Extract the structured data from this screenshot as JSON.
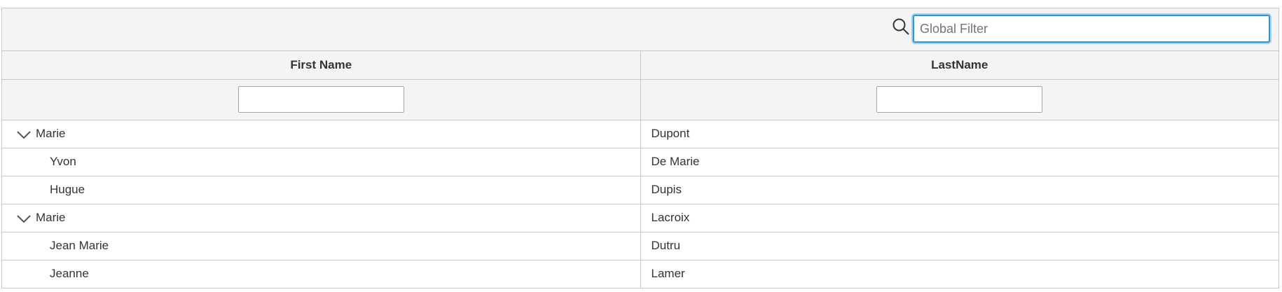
{
  "global_filter": {
    "placeholder": "Global Filter",
    "value": ""
  },
  "columns": [
    {
      "header": "First Name",
      "filter_value": ""
    },
    {
      "header": "LastName",
      "filter_value": ""
    }
  ],
  "rows": [
    {
      "first_name": "Marie",
      "last_name": "Dupont",
      "level": 0,
      "expanded": true
    },
    {
      "first_name": "Yvon",
      "last_name": "De Marie",
      "level": 1
    },
    {
      "first_name": "Hugue",
      "last_name": "Dupis",
      "level": 1
    },
    {
      "first_name": "Marie",
      "last_name": "Lacroix",
      "level": 0,
      "expanded": true
    },
    {
      "first_name": "Jean Marie",
      "last_name": "Dutru",
      "level": 1
    },
    {
      "first_name": "Jeanne",
      "last_name": "Lamer",
      "level": 1
    }
  ],
  "icons": {
    "search": "search-icon",
    "toggler": "chevron-down-icon"
  },
  "colors": {
    "header_bg": "#f4f4f4",
    "border": "#c8c8c8",
    "focus": "#2a96e2"
  }
}
